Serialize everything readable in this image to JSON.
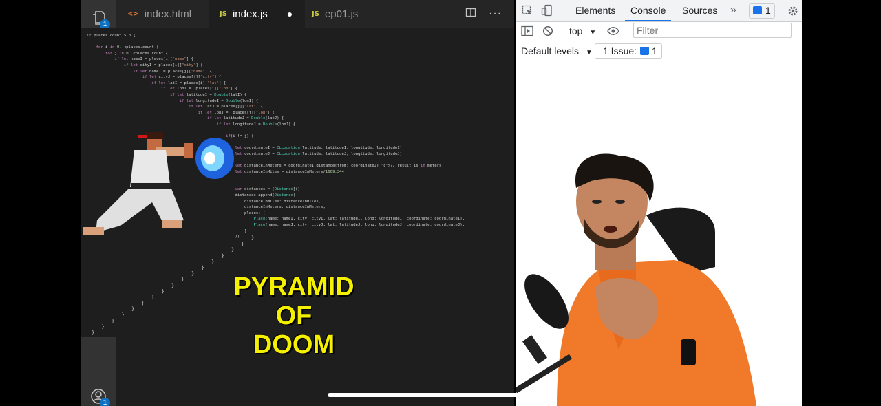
{
  "vscode": {
    "explorer_badge": "1",
    "account_badge": "1",
    "tabs": [
      {
        "icon": "<>",
        "label": "index.html"
      },
      {
        "icon": "JS",
        "label": "index.js"
      },
      {
        "icon": "JS",
        "label": "ep01.js"
      }
    ],
    "code_lines": [
      "if places.count > 0 {",
      "",
      "    for i in 0..<places.count {",
      "        for j in 0..<places.count {",
      "            if let nameI = places[i][\"name\"] {",
      "                if let cityI = places[i][\"city\"] {",
      "                    if let nameJ = places[j][\"name\"] {",
      "                        if let cityJ = places[j][\"city\"] {",
      "                            if let latI = places[i][\"lat\"] {",
      "                                if let lonI =  places[i][\"lon\"] {",
      "                                    if let latitudeI = Double(latI) {",
      "                                        if let longitudeI = Double(lonI) {",
      "                                            if let latJ = places[j][\"lat\"] {",
      "                                                if let lonJ =  places[j][\"lon\"] {",
      "                                                    if let latitudeJ = Double(latJ) {",
      "                                                        if let longitudeJ = Double(lonJ) {",
      "",
      "                                                            if(i != j) {",
      "",
      "                                                                let coordinateI = CLLocation(latitude: latitudeI, longitude: longitudeI)",
      "                                                                let coordinateJ = CLLocation(latitude: latitudeJ, longitude: longitudeJ)",
      "",
      "                                                                let distanceInMeters = coordinateI.distance(from: coordinateJ) // result is in meters",
      "                                                                let distanceInMiles = distanceInMeters/1609.344",
      "",
      "",
      "                                                                var distances = [Distance]()",
      "                                                                distances.append(Distance(",
      "                                                                    distanceInMiles: distanceInMiles,",
      "                                                                    distanceInMeters: distanceInMeters,",
      "                                                                    places: [",
      "                                                                        Place(name: nameI, city: cityI, lat: latitudeI, long: longitudeI, coordinate: coordinateI),",
      "                                                                        Place(name: nameJ, city: cityJ, lat: latitudeJ, long: longitudeJ, coordinate: coordinateJ),",
      "                                                                    ]",
      "                                                                ))"
    ],
    "caption_lines": [
      "PYRAMID",
      "OF",
      "DOOM"
    ]
  },
  "devtools": {
    "tabs": [
      "Elements",
      "Console",
      "Sources"
    ],
    "active_tab": "Console",
    "issues_badge": "1",
    "context": "top",
    "filter_placeholder": "Filter",
    "levels": "Default levels",
    "issues_text": "1 Issue:",
    "issues_count": "1",
    "prompt": "›"
  }
}
